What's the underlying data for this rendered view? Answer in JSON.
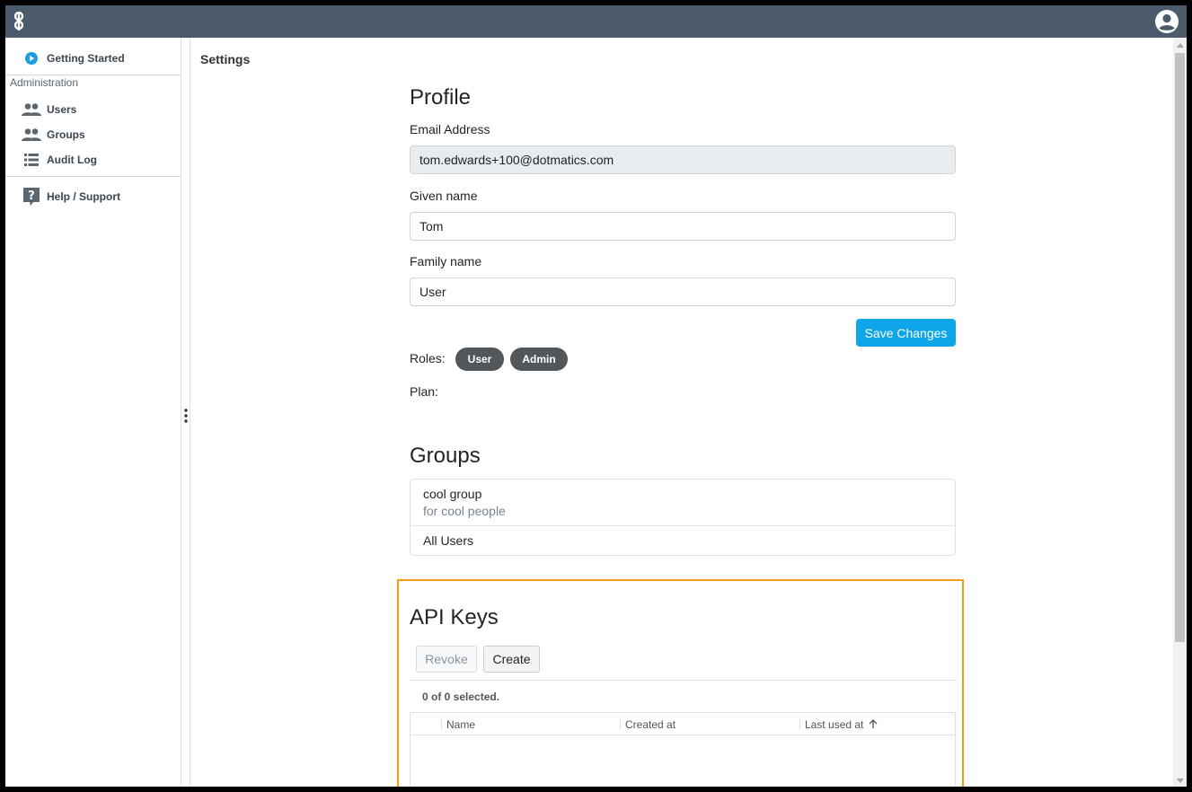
{
  "topbar": {
    "logo": "app-logo",
    "user_icon": "account-circle-icon",
    "bg": "#4b5b6b"
  },
  "sidebar": {
    "getting_started": "Getting Started",
    "section_label": "Administration",
    "items": [
      {
        "label": "Users",
        "icon": "people-icon"
      },
      {
        "label": "Groups",
        "icon": "people-icon"
      },
      {
        "label": "Audit Log",
        "icon": "list-icon"
      }
    ],
    "help": "Help / Support"
  },
  "main": {
    "page_title": "Settings",
    "profile": {
      "heading": "Profile",
      "email_label": "Email Address",
      "email_value": "tom.edwards+100@dotmatics.com",
      "given_label": "Given name",
      "given_value": "Tom",
      "family_label": "Family name",
      "family_value": "User",
      "save_label": "Save Changes",
      "roles_label": "Roles:",
      "roles": [
        "User",
        "Admin"
      ],
      "plan_label": "Plan:"
    },
    "groups": {
      "heading": "Groups",
      "items": [
        {
          "name": "cool group",
          "description": "for cool people"
        },
        {
          "name": "All Users",
          "description": ""
        }
      ]
    },
    "api_keys": {
      "heading": "API Keys",
      "revoke_label": "Revoke",
      "create_label": "Create",
      "selected_text": "0 of 0 selected.",
      "columns": [
        "Name",
        "Created at",
        "Last used at"
      ],
      "sort_column": "Last used at",
      "sort_direction": "ascending"
    }
  },
  "colors": {
    "accent": "#0ea5e9",
    "highlight": "#f59c12",
    "pill": "#52575c"
  }
}
